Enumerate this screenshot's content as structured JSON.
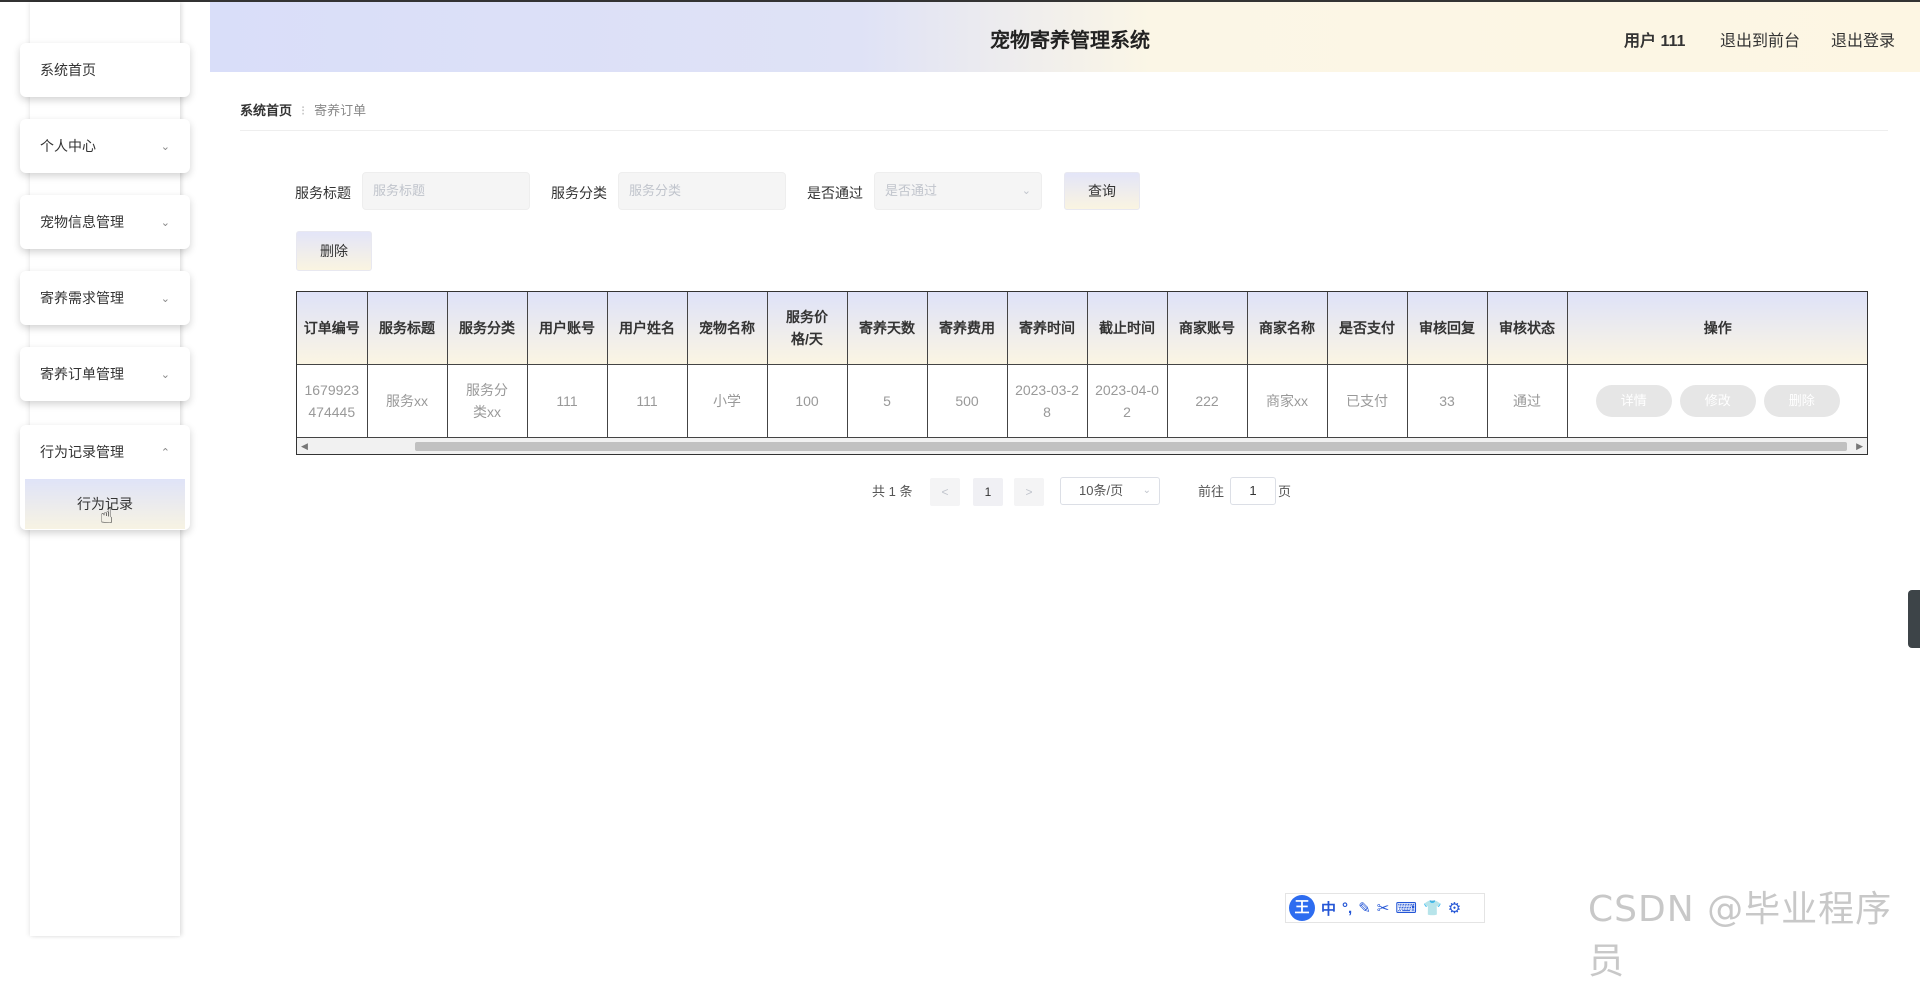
{
  "header": {
    "title": "宠物寄养管理系统",
    "user": "用户 111",
    "front": "退出到前台",
    "logout": "退出登录"
  },
  "sidebar": {
    "items": [
      {
        "label": "系统首页"
      },
      {
        "label": "个人中心"
      },
      {
        "label": "宠物信息管理"
      },
      {
        "label": "寄养需求管理"
      },
      {
        "label": "寄养订单管理"
      },
      {
        "label": "行为记录管理"
      }
    ],
    "sub_item": "行为记录"
  },
  "breadcrumb": {
    "home": "系统首页",
    "current": "寄养订单"
  },
  "search": {
    "title_label": "服务标题",
    "title_placeholder": "服务标题",
    "category_label": "服务分类",
    "category_placeholder": "服务分类",
    "pass_label": "是否通过",
    "pass_placeholder": "是否通过",
    "query_button": "查询",
    "delete_button": "删除"
  },
  "table": {
    "headers": [
      "订单编号",
      "服务标题",
      "服务分类",
      "用户账号",
      "用户姓名",
      "宠物名称",
      "服务价格/天",
      "寄养天数",
      "寄养费用",
      "寄养时间",
      "截止时间",
      "商家账号",
      "商家名称",
      "是否支付",
      "审核回复",
      "审核状态",
      "操作"
    ],
    "rows": [
      {
        "cells": [
          "1679923474445",
          "服务xx",
          "服务分类xx",
          "111",
          "111",
          "小学",
          "100",
          "5",
          "500",
          "2023-03-28",
          "2023-04-02",
          "222",
          "商家xx",
          "已支付",
          "33",
          "通过"
        ],
        "actions": [
          "详情",
          "修改",
          "删除"
        ]
      }
    ]
  },
  "pagination": {
    "total": "共 1 条",
    "prev": "<",
    "page": "1",
    "next": ">",
    "size": "10条/页",
    "goto_label": "前往",
    "goto_value": "1",
    "page_unit": "页"
  },
  "ime": {
    "logo": "王",
    "items": [
      "中",
      "°,",
      "✎",
      "✂",
      "⌨",
      "👕",
      "⚙"
    ]
  },
  "watermark": "CSDN @毕业程序员"
}
